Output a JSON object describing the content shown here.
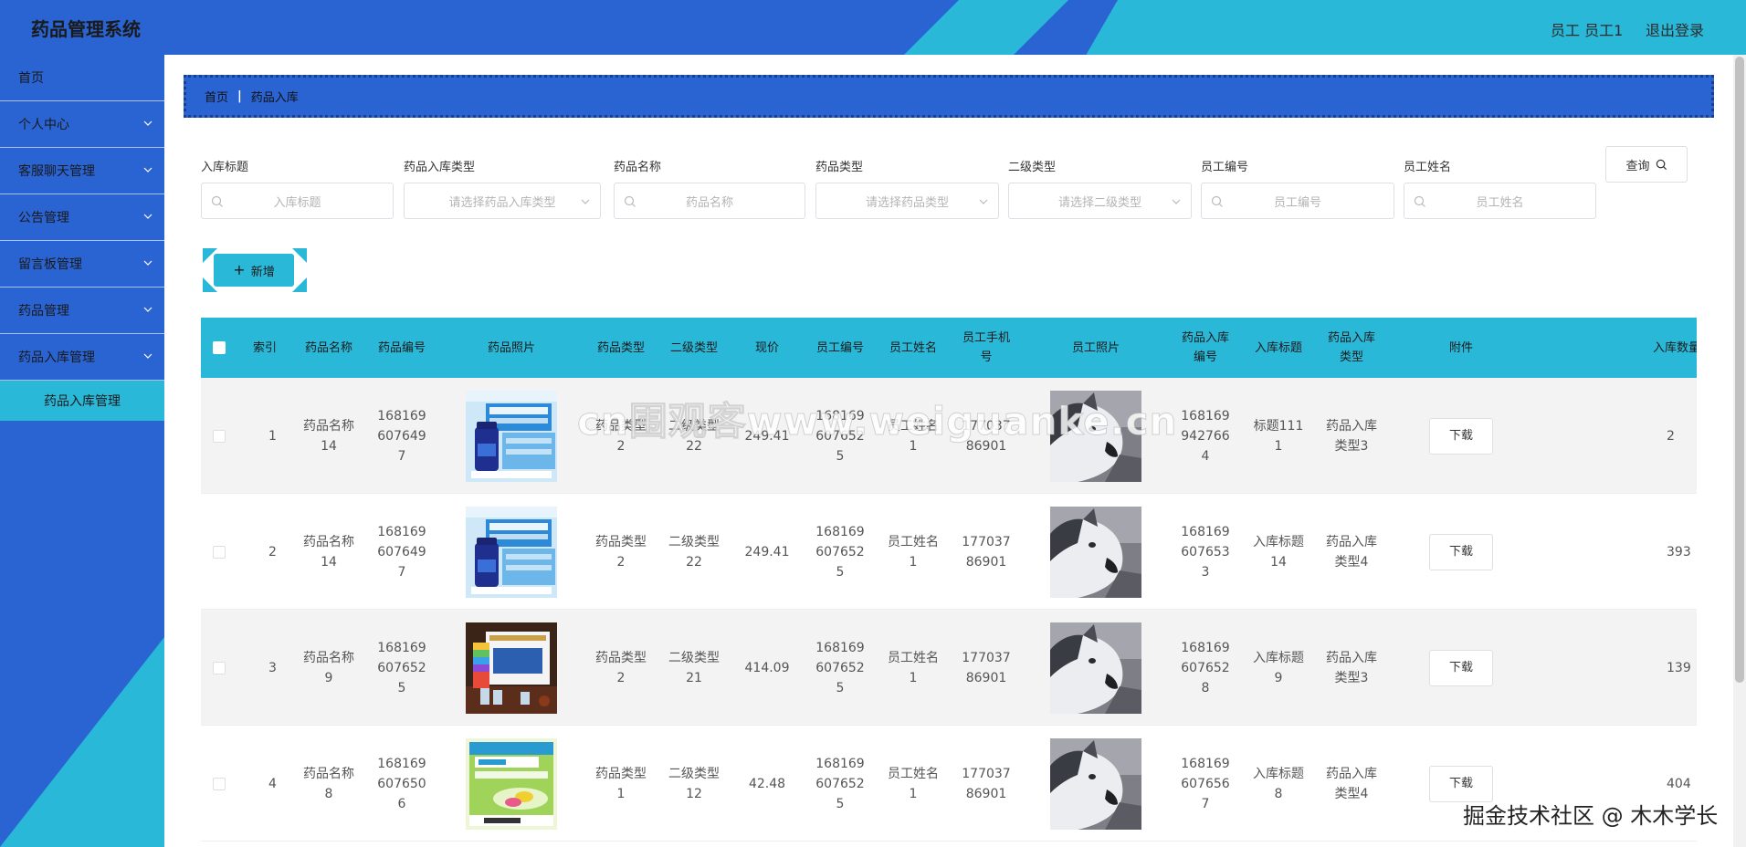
{
  "header": {
    "title": "药品管理系统",
    "user": "员工 员工1",
    "logout": "退出登录"
  },
  "sidebar": {
    "items": [
      {
        "label": "首页",
        "expandable": false
      },
      {
        "label": "个人中心",
        "expandable": true
      },
      {
        "label": "客服聊天管理",
        "expandable": true
      },
      {
        "label": "公告管理",
        "expandable": true
      },
      {
        "label": "留言板管理",
        "expandable": true
      },
      {
        "label": "药品管理",
        "expandable": true
      },
      {
        "label": "药品入库管理",
        "expandable": true
      }
    ],
    "active_sub": "药品入库管理"
  },
  "breadcrumb": {
    "home": "首页",
    "sep": "|",
    "current": "药品入库"
  },
  "search": {
    "fields": [
      {
        "label": "入库标题",
        "placeholder": "入库标题",
        "type": "text"
      },
      {
        "label": "药品入库类型",
        "placeholder": "请选择药品入库类型",
        "type": "select"
      },
      {
        "label": "药品名称",
        "placeholder": "药品名称",
        "type": "text"
      },
      {
        "label": "药品类型",
        "placeholder": "请选择药品类型",
        "type": "select"
      },
      {
        "label": "二级类型",
        "placeholder": "请选择二级类型",
        "type": "select"
      },
      {
        "label": "员工编号",
        "placeholder": "员工编号",
        "type": "text"
      },
      {
        "label": "员工姓名",
        "placeholder": "员工姓名",
        "type": "text"
      }
    ],
    "query_label": "查询"
  },
  "add_button": {
    "label": "新增"
  },
  "table": {
    "headers": {
      "index": "索引",
      "drug_name": "药品名称",
      "drug_no": "药品编号",
      "drug_photo": "药品照片",
      "drug_type": "药品类型",
      "sub_type": "二级类型",
      "price": "现价",
      "emp_no": "员工编号",
      "emp_name": "员工姓名",
      "emp_phone": "员工手机号",
      "emp_photo": "员工照片",
      "in_no": "药品入库编号",
      "in_title": "入库标题",
      "in_type": "药品入库类型",
      "attachment": "附件",
      "in_qty": "入库数量"
    },
    "download_label": "下载",
    "rows": [
      {
        "index": "1",
        "drug_name": "药品名称14",
        "drug_no": "1681696076497",
        "drug_photo": "blue-box",
        "drug_type": "药品类型2",
        "sub_type": "二级类型22",
        "price": "249.41",
        "emp_no": "1681696076525",
        "emp_name": "员工姓名1",
        "emp_phone": "17703786901",
        "in_no": "1681699427664",
        "in_title": "标题1111",
        "in_type": "药品入库类型3",
        "in_qty": "2"
      },
      {
        "index": "2",
        "drug_name": "药品名称14",
        "drug_no": "1681696076497",
        "drug_photo": "blue-box",
        "drug_type": "药品类型2",
        "sub_type": "二级类型22",
        "price": "249.41",
        "emp_no": "1681696076525",
        "emp_name": "员工姓名1",
        "emp_phone": "17703786901",
        "in_no": "1681696076533",
        "in_title": "入库标题14",
        "in_type": "药品入库类型4",
        "in_qty": "393"
      },
      {
        "index": "3",
        "drug_name": "药品名称9",
        "drug_no": "1681696076525",
        "drug_photo": "dark-product",
        "drug_type": "药品类型2",
        "sub_type": "二级类型21",
        "price": "414.09",
        "emp_no": "1681696076525",
        "emp_name": "员工姓名1",
        "emp_phone": "17703786901",
        "in_no": "1681696076528",
        "in_title": "入库标题9",
        "in_type": "药品入库类型3",
        "in_qty": "139"
      },
      {
        "index": "4",
        "drug_name": "药品名称8",
        "drug_no": "1681696076506",
        "drug_photo": "green-box",
        "drug_type": "药品类型1",
        "sub_type": "二级类型12",
        "price": "42.48",
        "emp_no": "1681696076525",
        "emp_name": "员工姓名1",
        "emp_phone": "17703786901",
        "in_no": "1681696076567",
        "in_title": "入库标题8",
        "in_type": "药品入库类型4",
        "in_qty": "404"
      }
    ]
  },
  "watermark": {
    "center": "cn围观客www.weiguanke.cn",
    "bottom": "掘金技术社区 @ 木木学长"
  },
  "colors": {
    "primary": "#2a63d2",
    "accent": "#2ab8d8",
    "row_stripe": "#f3f3f3"
  }
}
